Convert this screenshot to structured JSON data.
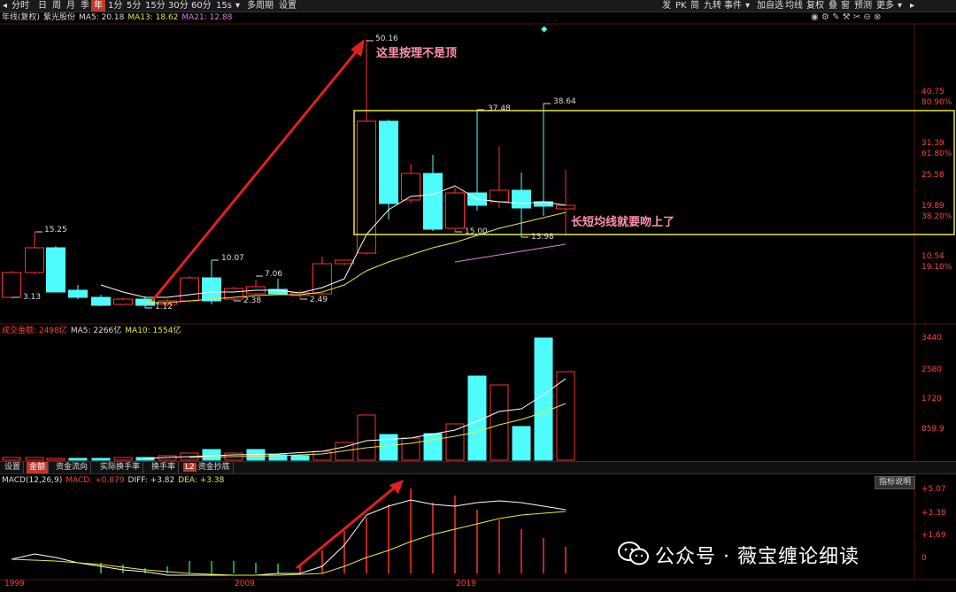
{
  "toolbar": {
    "left": [
      "分时",
      "日",
      "周",
      "月",
      "季",
      "年",
      "1分",
      "5分",
      "15分",
      "30分",
      "60分",
      "15s",
      "多周期",
      "设置"
    ],
    "active_index": 5,
    "right": [
      "发",
      "PK",
      "简",
      "九转",
      "事件",
      "加自选",
      "均线",
      "复权",
      "叠",
      "窗",
      "预测",
      "更多"
    ]
  },
  "price_header": {
    "title": "年线(复权)",
    "stock": "紫光股份",
    "ma5": "MA5: 20.18",
    "ma13": "MA13: 18.62",
    "ma21": "MA21: 12.88"
  },
  "price_axis": [
    {
      "value": "40.75",
      "pct": "80.90%"
    },
    {
      "value": "31.39",
      "pct": "61.80%"
    },
    {
      "value": "25.58",
      "pct": ""
    },
    {
      "value": "19.89",
      "pct": "38.20%"
    },
    {
      "value": "10.54",
      "pct": "19.10%"
    }
  ],
  "price_labels": [
    "50.16",
    "37.48",
    "38.64",
    "15.25",
    "10.07",
    "7.06",
    "3.13",
    "1.12",
    "2.38",
    "2.49",
    "15.00",
    "13.98"
  ],
  "annotations": {
    "top": "这里按理不是顶",
    "right": "长短均线就要吻上了"
  },
  "volume_header": {
    "label": "成交金额: 2498亿",
    "ma5": "MA5: 2266亿",
    "ma10": "MA10: 1554亿"
  },
  "volume_axis": [
    "3440",
    "2580",
    "1720",
    "859.9"
  ],
  "tabs": [
    "设置",
    "金额",
    "资金流向",
    "实际换手率",
    "换手率",
    "资金抄底"
  ],
  "tab_active": 1,
  "tab_badge": "L2",
  "macd_header": {
    "label": "MACD(12,26,9)",
    "macd": "MACD: +0.879",
    "diff": "DIFF: +3.82",
    "dea": "DEA: +3.38"
  },
  "macd_axis": [
    "+5.07",
    "+3.38",
    "+1.69",
    "0"
  ],
  "legend_button": "指标说明",
  "years": [
    "1999",
    "2009",
    "2019"
  ],
  "watermark": "公众号 · 薇宝缠论细读",
  "colors": {
    "up": "#ff3030",
    "down": "#4ffcfc",
    "ma5": "#ffffff",
    "ma13": "#e8e83a",
    "ma21": "#e07fe0",
    "box": "#e8e83a",
    "arrow": "#e02020"
  },
  "icons": [
    "eye-icon",
    "settings-icon",
    "edit-icon",
    "tools-icon",
    "scissors-icon",
    "minimize-icon",
    "close-icon"
  ]
}
